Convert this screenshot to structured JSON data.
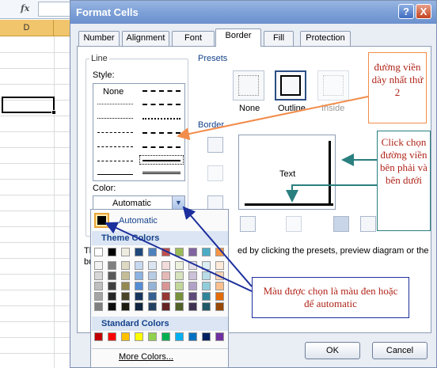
{
  "excel": {
    "fx_label": "fx",
    "column_header": "D"
  },
  "dialog": {
    "title": "Format Cells",
    "help": "?",
    "close": "X",
    "tabs": [
      "Number",
      "Alignment",
      "Font",
      "Border",
      "Fill",
      "Protection"
    ],
    "active_tab": "Border",
    "line_group": "Line",
    "style_label": "Style:",
    "style_none": "None",
    "color_label": "Color:",
    "color_value": "Automatic",
    "presets_label": "Presets",
    "presets": [
      "None",
      "Outline",
      "Inside"
    ],
    "border_label": "Border",
    "preview_text": "Text",
    "hint_text": "The selected border style can be applied by clicking the presets, preview diagram or the buttons above.",
    "hint_visible_left": "Th",
    "hint_visible_left2": "bu",
    "hint_visible_right": "ed by clicking the presets, preview diagram or the",
    "ok": "OK",
    "cancel": "Cancel"
  },
  "color_dropdown": {
    "automatic": "Automatic",
    "theme_colors": "Theme Colors",
    "standard_colors": "Standard Colors",
    "more_colors": "More Colors...",
    "theme_top": [
      "#ffffff",
      "#000000",
      "#eeece1",
      "#1f497d",
      "#4f81bd",
      "#c0504d",
      "#9bbb59",
      "#8064a2",
      "#4bacc6",
      "#f79646"
    ],
    "theme_tints": [
      [
        "#f2f2f2",
        "#7f7f7f",
        "#ddd9c3",
        "#c6d9f0",
        "#dbe5f1",
        "#f2dcdb",
        "#ebf1dd",
        "#e5e0ec",
        "#dbeef3",
        "#fdeada"
      ],
      [
        "#d8d8d8",
        "#595959",
        "#c4bd97",
        "#8db3e2",
        "#b8cce4",
        "#e5b9b7",
        "#d7e3bc",
        "#ccc1d9",
        "#b7dde8",
        "#fbd5b5"
      ],
      [
        "#bfbfbf",
        "#3f3f3f",
        "#938953",
        "#548dd4",
        "#95b3d7",
        "#d99694",
        "#c3d69b",
        "#b2a2c7",
        "#92cddc",
        "#fac08f"
      ],
      [
        "#a5a5a5",
        "#262626",
        "#494429",
        "#17365d",
        "#366092",
        "#953734",
        "#76923c",
        "#5f497a",
        "#31859b",
        "#e36c09"
      ],
      [
        "#7f7f7f",
        "#0c0c0c",
        "#1d1b10",
        "#0f243e",
        "#244061",
        "#632423",
        "#4f6128",
        "#3f3151",
        "#205867",
        "#974806"
      ]
    ],
    "standard": [
      "#c00000",
      "#ff0000",
      "#ffc000",
      "#ffff00",
      "#92d050",
      "#00b050",
      "#00b0f0",
      "#0070c0",
      "#002060",
      "#7030a0"
    ]
  },
  "callouts": {
    "top_right": "đường viền dày nhất thứ 2",
    "right": "Click chọn đường viền bên phải và bên dưới",
    "bottom": "Màu được chọn là màu đen hoặc để automatic"
  },
  "colors": {
    "callout_text": "#b0251a",
    "arrow_orange": "#f28c4a",
    "arrow_teal": "#2a7f7f",
    "arrow_blue": "#1c2f9c"
  }
}
